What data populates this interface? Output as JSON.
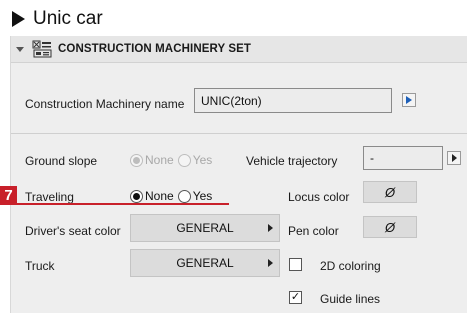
{
  "heading": {
    "label": "Unic car"
  },
  "panel": {
    "title": "CONSTRUCTION MACHINERY SET",
    "machinery_name": {
      "label": "Construction Machinery name",
      "value": "UNIC(2ton)"
    },
    "ground_slope": {
      "label": "Ground slope",
      "options": [
        "None",
        "Yes"
      ],
      "selected": "None",
      "enabled": false
    },
    "vehicle_trajectory": {
      "label": "Vehicle trajectory",
      "value": "-"
    },
    "traveling": {
      "label": "Traveling",
      "options": [
        "None",
        "Yes"
      ],
      "selected": "None",
      "enabled": true
    },
    "locus_color": {
      "label": "Locus color",
      "symbol": "Ø"
    },
    "drivers_seat_color": {
      "label": "Driver's seat color",
      "value": "GENERAL"
    },
    "pen_color": {
      "label": "Pen color",
      "symbol": "Ø"
    },
    "truck": {
      "label": "Truck",
      "value": "GENERAL"
    },
    "coloring_2d": {
      "label": "2D coloring",
      "checked": false
    },
    "guide_lines": {
      "label": "Guide lines",
      "checked": true,
      "mark": "✓"
    }
  },
  "callout": {
    "number": "7"
  },
  "colors": {
    "accent": "#c8202a",
    "link_arrow": "#1d5fb8",
    "panel_bg": "#eeeeee"
  }
}
